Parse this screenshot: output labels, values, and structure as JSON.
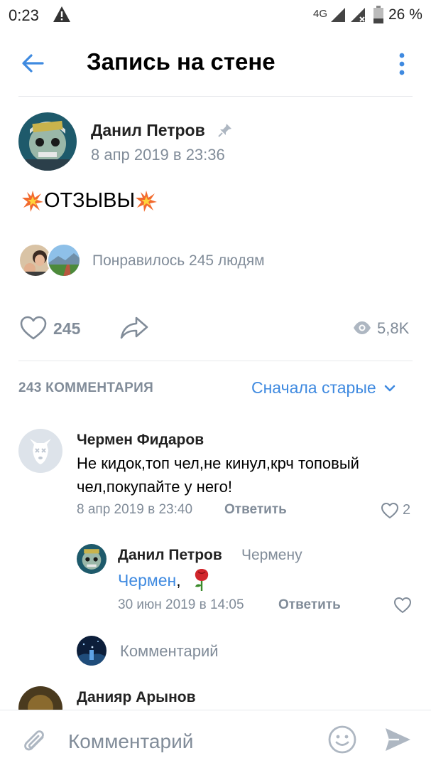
{
  "status_bar": {
    "time": "0:23",
    "network": "4G",
    "battery_percent": "26 %"
  },
  "header": {
    "title": "Запись на стене",
    "back_icon": "arrow-left-icon",
    "menu_icon": "more-vertical-icon"
  },
  "post": {
    "author": "Данил Петров",
    "date": "8 апр 2019 в 23:36",
    "text": "ОТЗЫВЫ",
    "liked_by_text": "Понравилось 245 людям",
    "likes": "245",
    "views": "5,8K"
  },
  "comments_section": {
    "count_label": "243 КОММЕНТАРИЯ",
    "sort_label": "Сначала старые"
  },
  "comments": [
    {
      "author": "Чермен Фидаров",
      "text": "Не кидок,топ чел,не кинул,крч топовый чел,покупайте у него!",
      "date": "8 апр 2019 в 23:40",
      "reply_label": "Ответить",
      "likes": "2"
    },
    {
      "author": "Данил Петров",
      "reply_to": "Чермену",
      "mention": "Чермен",
      "text_rest": ",",
      "date": "30 июн 2019 в 14:05",
      "reply_label": "Ответить"
    }
  ],
  "reply_input_placeholder": "Комментарий",
  "next_comment_author": "Данияр Арынов",
  "composer": {
    "placeholder": "Комментарий"
  },
  "colors": {
    "accent": "#3f8ae0",
    "secondary_text": "#818c99",
    "divider": "#e7e8ec"
  }
}
